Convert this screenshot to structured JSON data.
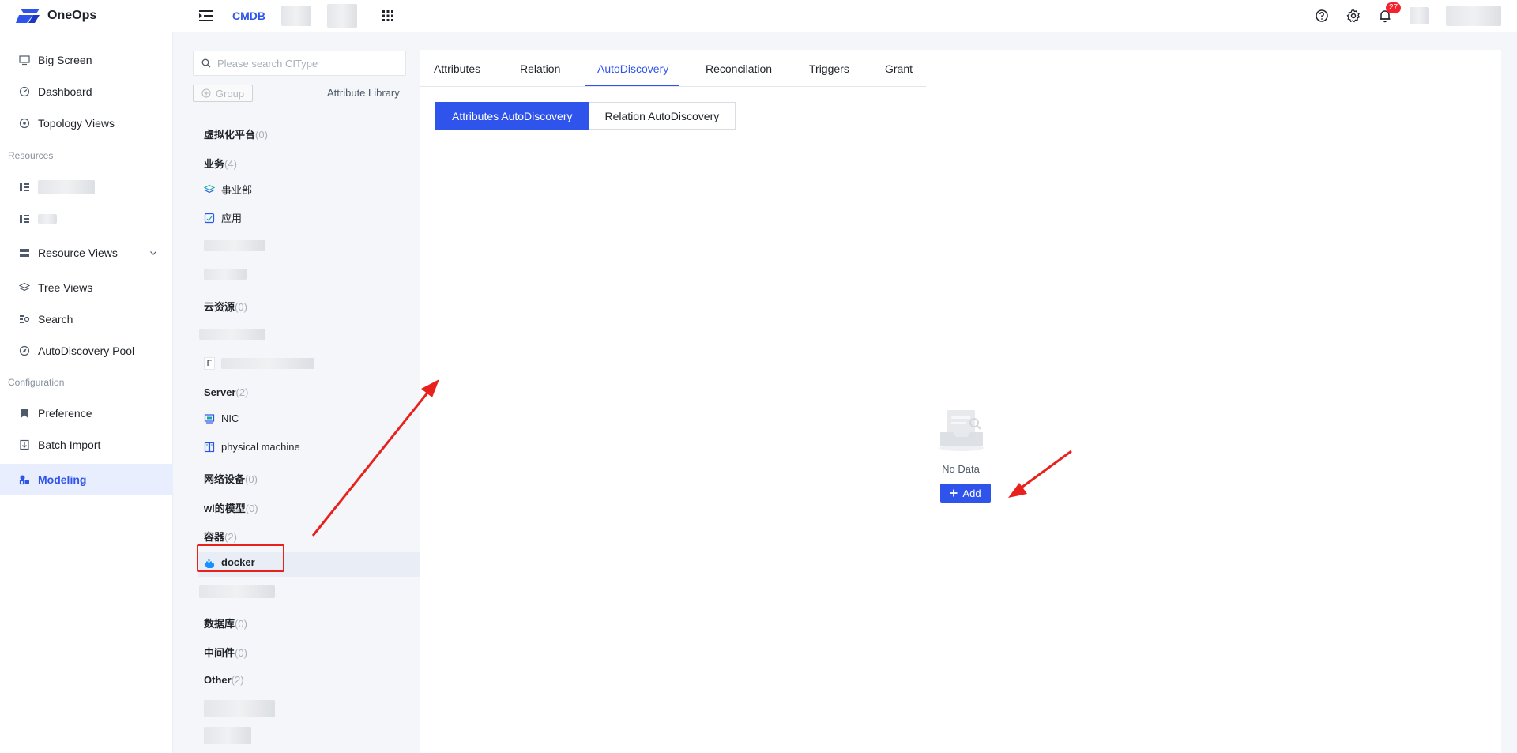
{
  "topbar": {
    "logo_text": "OneOps",
    "app_name": "CMDB",
    "notification_count": "27"
  },
  "sidebar": {
    "items_top": [
      "Big Screen",
      "Dashboard",
      "Topology Views"
    ],
    "section_resources": "Resources",
    "items_resources": [
      "Resource Views",
      "Tree Views",
      "Search",
      "AutoDiscovery Pool"
    ],
    "section_configuration": "Configuration",
    "items_configuration": [
      "Preference",
      "Batch Import",
      "Modeling"
    ]
  },
  "ci_panel": {
    "search_placeholder": "Please search CIType",
    "group_button": "Group",
    "attribute_library": "Attribute Library",
    "groups": [
      {
        "name": "虚拟化平台",
        "count": "(0)"
      },
      {
        "name": "业务",
        "count": "(4)"
      },
      {
        "name": "云资源",
        "count": "(0)"
      },
      {
        "name": "Server",
        "count": "(2)"
      },
      {
        "name": "网络设备",
        "count": "(0)"
      },
      {
        "name": "wl的模型",
        "count": "(0)"
      },
      {
        "name": "容器",
        "count": "(2)"
      },
      {
        "name": "数据库",
        "count": "(0)"
      },
      {
        "name": "中间件",
        "count": "(0)"
      },
      {
        "name": "Other",
        "count": "(2)"
      }
    ],
    "items": {
      "biz1": "事业部",
      "biz2": "应用",
      "cloud_f": "F",
      "server1": "NIC",
      "server2": "physical machine",
      "container1": "docker"
    }
  },
  "main": {
    "tabs": [
      "Attributes",
      "Relation",
      "AutoDiscovery",
      "Reconcilation",
      "Triggers",
      "Grant"
    ],
    "active_tab": "AutoDiscovery",
    "segments": [
      "Attributes AutoDiscovery",
      "Relation AutoDiscovery"
    ],
    "empty_text": "No Data",
    "add_label": "Add"
  },
  "colors": {
    "primary": "#2f54eb",
    "annotation": "#e8211d",
    "badge": "#f5222d"
  }
}
